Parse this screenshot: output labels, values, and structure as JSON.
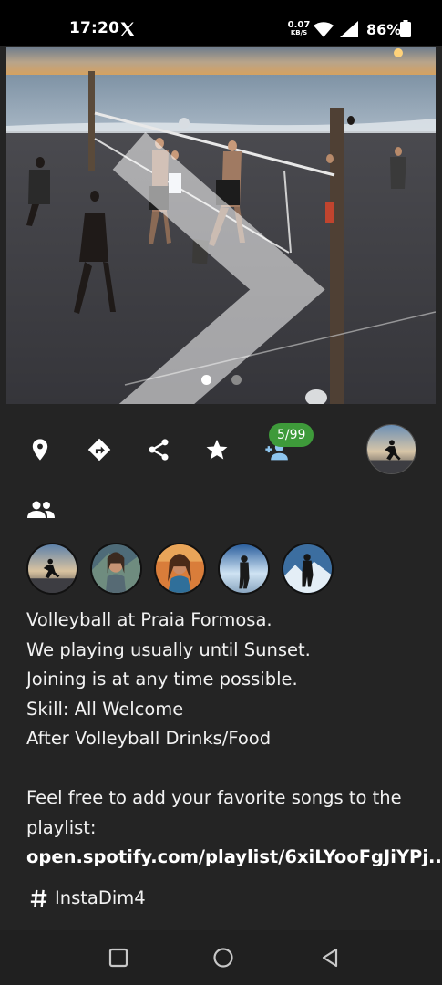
{
  "status_bar": {
    "time": "17:20",
    "notification_icon": "x-logo-icon",
    "net_speed_value": "0.07",
    "net_speed_unit": "KB/S",
    "battery_percent": "86%"
  },
  "event": {
    "photo": {
      "description_icon": "beach-volleyball-photo",
      "page_count": 2,
      "current_page": 1
    },
    "actions": {
      "location_icon": "location-pin-icon",
      "directions_icon": "directions-icon",
      "share_icon": "share-icon",
      "favorite_icon": "star-icon",
      "join_icon": "add-person-icon",
      "participant_count": "5/99"
    },
    "description_lines": [
      "Volleyball at Praia Formosa.",
      "We playing usually until Sunset.",
      "Joining is at any time possible.",
      "Skill: All Welcome",
      "After Volleyball Drinks/Food",
      "",
      "Feel free to add your favorite songs to the",
      "playlist:"
    ],
    "link": "open.spotify.com/playlist/6xiLYooFgJiYPj..",
    "hashtag": "InstaDim4"
  },
  "colors": {
    "card_bg": "#242424",
    "badge_green": "#3e9a3a",
    "text": "#f2f2f2"
  }
}
